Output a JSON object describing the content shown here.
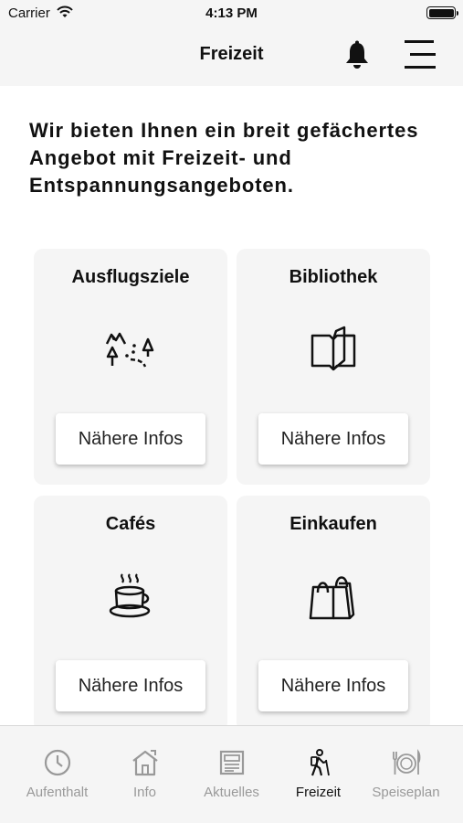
{
  "status_bar": {
    "carrier": "Carrier",
    "time": "4:13 PM"
  },
  "header": {
    "title": "Freizeit"
  },
  "intro_text": "Wir bieten Ihnen ein breit gefächertes Angebot mit Freizeit- und Entspannungsangeboten.",
  "tiles": [
    {
      "title": "Ausflugsziele",
      "icon": "hiking-trail-icon",
      "button_label": "Nähere Infos"
    },
    {
      "title": "Bibliothek",
      "icon": "open-book-icon",
      "button_label": "Nähere Infos"
    },
    {
      "title": "Cafés",
      "icon": "coffee-cup-icon",
      "button_label": "Nähere Infos"
    },
    {
      "title": "Einkaufen",
      "icon": "shopping-bag-icon",
      "button_label": "Nähere Infos"
    }
  ],
  "tab_bar": {
    "active": "Freizeit",
    "tabs": [
      {
        "label": "Aufenthalt",
        "icon": "clock-icon"
      },
      {
        "label": "Info",
        "icon": "house-icon"
      },
      {
        "label": "Aktuelles",
        "icon": "newspaper-icon"
      },
      {
        "label": "Freizeit",
        "icon": "hiker-icon"
      },
      {
        "label": "Speiseplan",
        "icon": "cutlery-icon"
      }
    ]
  },
  "colors": {
    "background": "#ffffff",
    "bar": "#f5f5f5",
    "tile": "#f5f5f5",
    "text": "#111111",
    "inactive_tab": "#999999"
  }
}
